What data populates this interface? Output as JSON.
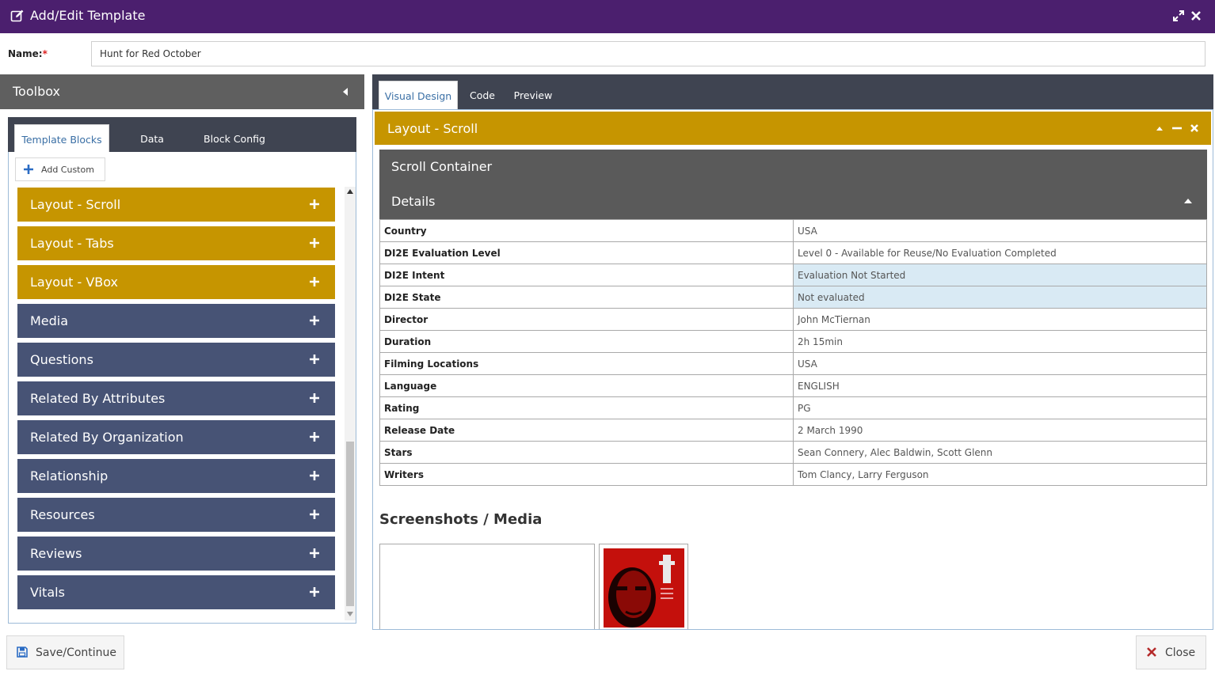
{
  "window": {
    "title": "Add/Edit Template"
  },
  "name_field": {
    "label": "Name:",
    "required_mark": "*",
    "value": "Hunt for Red October"
  },
  "toolbox": {
    "title": "Toolbox",
    "tabs": [
      {
        "label": "Template Blocks",
        "active": true
      },
      {
        "label": "Data",
        "active": false
      },
      {
        "label": "Block Config",
        "active": false
      }
    ],
    "add_custom_label": "Add Custom",
    "blocks": [
      {
        "label": "Layout - Scroll",
        "color": "#c69500"
      },
      {
        "label": "Layout - Tabs",
        "color": "#c69500"
      },
      {
        "label": "Layout - VBox",
        "color": "#c69500"
      },
      {
        "label": "Media",
        "color": "#475375"
      },
      {
        "label": "Questions",
        "color": "#475375"
      },
      {
        "label": "Related By Attributes",
        "color": "#475375"
      },
      {
        "label": "Related By Organization",
        "color": "#475375"
      },
      {
        "label": "Relationship",
        "color": "#475375"
      },
      {
        "label": "Resources",
        "color": "#475375"
      },
      {
        "label": "Reviews",
        "color": "#475375"
      },
      {
        "label": "Vitals",
        "color": "#475375"
      }
    ]
  },
  "design": {
    "tabs": [
      {
        "label": "Visual Design",
        "active": true
      },
      {
        "label": "Code",
        "active": false
      },
      {
        "label": "Preview",
        "active": false
      }
    ],
    "layout_block_title": "Layout - Scroll",
    "scroll_container_title": "Scroll Container",
    "details_title": "Details",
    "attributes": [
      {
        "key": "Country",
        "value": "USA",
        "highlight": false
      },
      {
        "key": "DI2E Evaluation Level",
        "value": "Level 0 - Available for Reuse/No Evaluation Completed",
        "highlight": false
      },
      {
        "key": "DI2E Intent",
        "value": "Evaluation Not Started",
        "highlight": true
      },
      {
        "key": "DI2E State",
        "value": "Not evaluated",
        "highlight": true
      },
      {
        "key": "Director",
        "value": "John McTiernan",
        "highlight": false
      },
      {
        "key": "Duration",
        "value": "2h 15min",
        "highlight": false
      },
      {
        "key": "Filming Locations",
        "value": "USA",
        "highlight": false
      },
      {
        "key": "Language",
        "value": "ENGLISH",
        "highlight": false
      },
      {
        "key": "Rating",
        "value": "PG",
        "highlight": false
      },
      {
        "key": "Release Date",
        "value": "2 March 1990",
        "highlight": false
      },
      {
        "key": "Stars",
        "value": "Sean Connery, Alec Baldwin, Scott Glenn",
        "highlight": false
      },
      {
        "key": "Writers",
        "value": "Tom Clancy, Larry Ferguson",
        "highlight": false
      }
    ],
    "media_title": "Screenshots / Media"
  },
  "footer": {
    "save_label": "Save/Continue",
    "close_label": "Close"
  },
  "colors": {
    "title_bar": "#4b1f6e",
    "gold_block": "#c69500",
    "slate_block": "#475375",
    "highlight_row": "#d9eaf4"
  }
}
